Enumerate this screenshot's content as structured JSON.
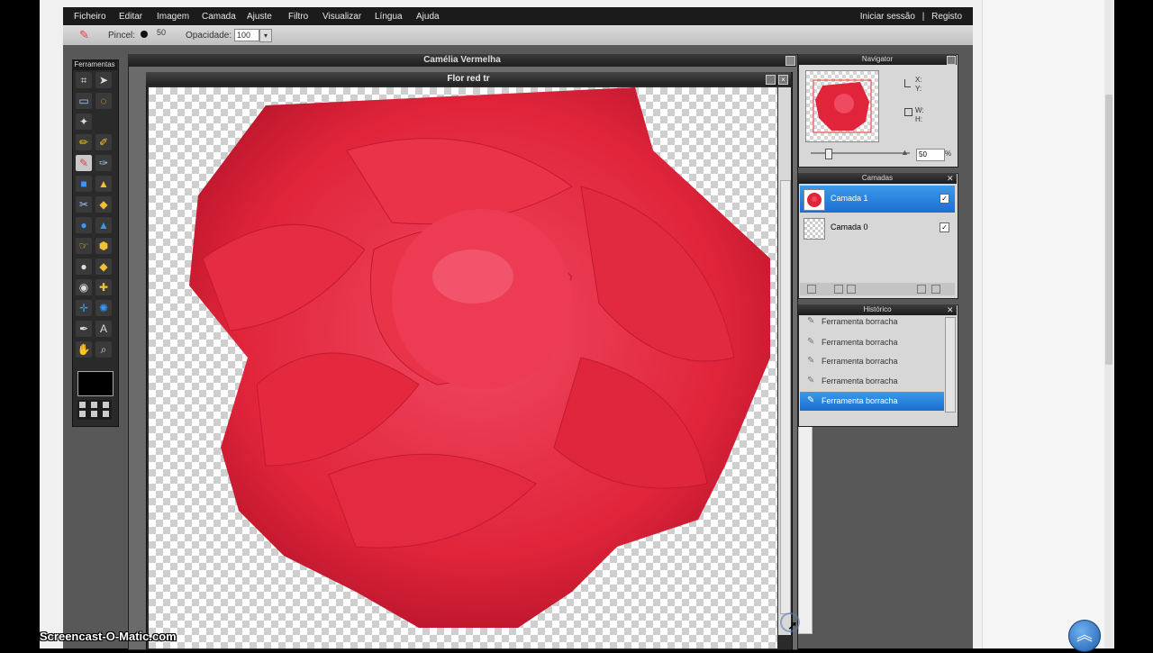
{
  "menubar": {
    "items": [
      "Ficheiro",
      "Editar",
      "Imagem",
      "Camada",
      "Ajuste",
      "Filtro",
      "Visualizar",
      "Língua",
      "Ajuda"
    ],
    "auth_login": "Iniciar sessão",
    "auth_sep": "|",
    "auth_register": "Registo"
  },
  "options_bar": {
    "brush_label": "Pincel:",
    "brush_size": "50",
    "opacity_label": "Opacidade:",
    "opacity_value": "100"
  },
  "tools_panel": {
    "title": "Ferramentas"
  },
  "main_window": {
    "title": "Camélia Vermelha"
  },
  "document": {
    "title": "Flor red tr"
  },
  "navigator": {
    "title": "Navigator",
    "x_label": "X:",
    "y_label": "Y:",
    "w_label": "W:",
    "h_label": "H:",
    "zoom_value": "50",
    "zoom_unit": "%"
  },
  "layers": {
    "title": "Camadas",
    "items": [
      {
        "name": "Camada 1",
        "selected": true,
        "visible": true
      },
      {
        "name": "Camada 0",
        "selected": false,
        "visible": true
      }
    ]
  },
  "history": {
    "title": "Histórico",
    "items": [
      {
        "label": "Ferramenta borracha",
        "selected": false
      },
      {
        "label": "Ferramenta borracha",
        "selected": false
      },
      {
        "label": "Ferramenta borracha",
        "selected": false
      },
      {
        "label": "Ferramenta borracha",
        "selected": false
      },
      {
        "label": "Ferramenta borracha",
        "selected": true
      }
    ]
  },
  "watermark": "Screencast-O-Matic.com",
  "colors": {
    "selection_blue": "#1a6fd0",
    "flower_red": "#e0243a"
  }
}
